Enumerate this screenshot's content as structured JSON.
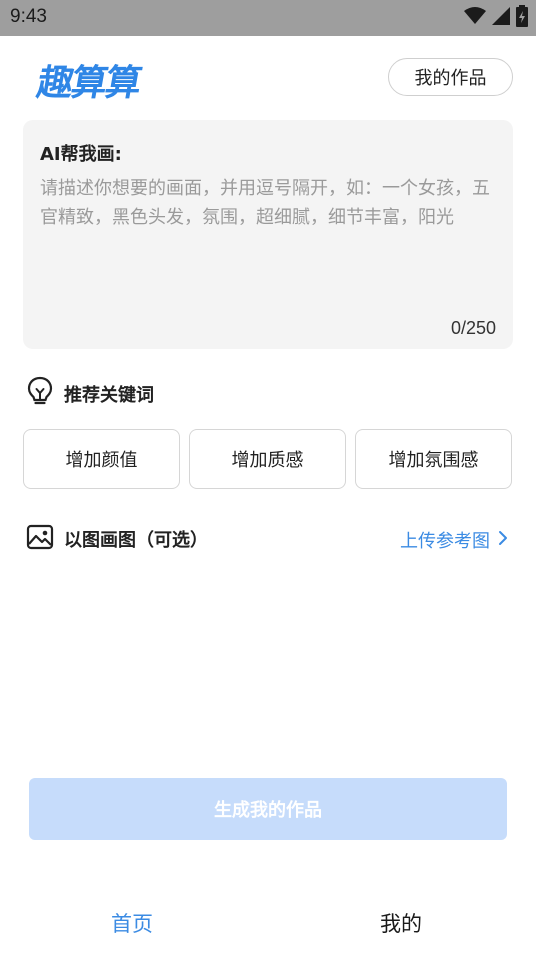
{
  "status_bar": {
    "time": "9:43",
    "icons": [
      "wifi-icon",
      "cellular-signal-icon",
      "battery-icon"
    ]
  },
  "header": {
    "logo_text": "趣算算",
    "my_works_label": "我的作品"
  },
  "prompt": {
    "label": "AI帮我画:",
    "placeholder": "请描述你想要的画面，并用逗号隔开，如：一个女孩，五官精致，黑色头发，氛围，超细腻，细节丰富，阳光",
    "value": "",
    "counter": "0/250"
  },
  "keywords": {
    "title": "推荐关键词",
    "icon": "lightbulb-icon",
    "items": [
      "增加颜值",
      "增加质感",
      "增加氛围感"
    ]
  },
  "image_to_image": {
    "title": "以图画图（可选）",
    "icon": "image-icon",
    "upload_label": "上传参考图",
    "upload_icon": "chevron-right-icon"
  },
  "generate_button": {
    "label": "生成我的作品"
  },
  "bottom_nav": {
    "items": [
      {
        "label": "首页",
        "active": true
      },
      {
        "label": "我的",
        "active": false
      }
    ]
  },
  "colors": {
    "accent": "#3b8be3",
    "logo": "#2f86e6",
    "button_disabled": "#c6dcfb",
    "card_bg": "#f4f4f4",
    "status_bar": "#9e9e9e"
  }
}
